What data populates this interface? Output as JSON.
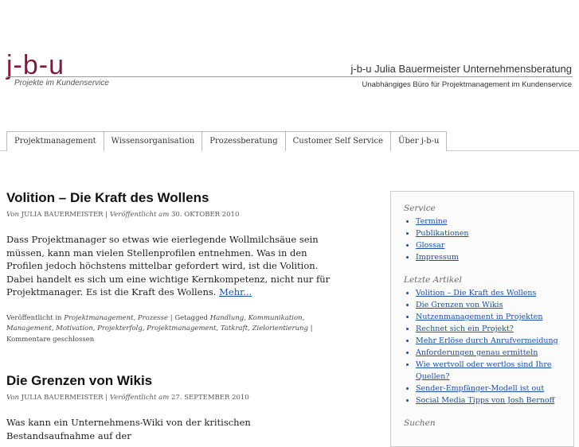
{
  "header": {
    "logo": "j-b-u",
    "tagline": "Projekte im Kundenservice",
    "company_name": "j-b-u Julia Bauermeister Unternehmensberatung",
    "company_sub": "Unabhängiges Büro für Projektmanagement im Kundenservice"
  },
  "nav": {
    "items": [
      {
        "label": "Projektmanagement"
      },
      {
        "label": "Wissensorganisation"
      },
      {
        "label": "Prozessberatung"
      },
      {
        "label": "Customer Self Service"
      },
      {
        "label": "Über j-b-u"
      }
    ]
  },
  "posts": [
    {
      "title": "Volition – Die Kraft des Wollens",
      "by": "Von",
      "author": "JULIA BAUERMEISTER",
      "published_label": "Veröffentlicht am",
      "date": "30. OKTOBER 2010",
      "excerpt": "Dass Projektmanager so etwas wie eierlegende Wollmilchsäue sein müssen, kann man vielen Stellenprofilen entnehmen. Was in den Profilen jedoch höchstens mittelbar gefordert wird, ist die Volition. Dabei handelt es sich um eine wichtige Kernkompetenz, nicht nur für Projektmanager. Es ist die Kraft des Wollens.",
      "more": "Mehr...",
      "category_label": "Veröffentlicht in",
      "categories": "Projektmanagement, Prozesse",
      "tag_label": "Getagged",
      "tags": "Handlung, Kommunikation, Management, Motivation, Projekterfolg, Projektmanagement, Tatkraft, Zielorientierung",
      "comments": "Kommentare geschlossen"
    },
    {
      "title": "Die Grenzen von Wikis",
      "by": "Von",
      "author": "JULIA BAUERMEISTER",
      "published_label": "Veröffentlicht am",
      "date": "27. SEPTEMBER 2010",
      "excerpt": "Was kann ein Unternehmens-Wiki von der kritischen Bestandsaufnahme auf der"
    }
  ],
  "sidebar": {
    "service_title": "Service",
    "service_items": [
      {
        "label": "Termine"
      },
      {
        "label": "Publikationen"
      },
      {
        "label": "Glossar"
      },
      {
        "label": "Impressum"
      }
    ],
    "recent_title": "Letzte Artikel",
    "recent_items": [
      {
        "label": "Volition – Die Kraft des Wollens"
      },
      {
        "label": "Die Grenzen von Wikis"
      },
      {
        "label": "Nutzenmanagement in Projekten"
      },
      {
        "label": "Rechnet sich ein Projekt?"
      },
      {
        "label": "Mehr Erlöse durch Anrufvermeidung"
      },
      {
        "label": "Anforderungen genau ermitteln"
      },
      {
        "label": "Wie wertvoll oder wertlos sind Ihre Quellen?"
      },
      {
        "label": "Sender-Empfänger-Modell ist out"
      },
      {
        "label": "Social Media Tipps von Josh Bernoff"
      }
    ],
    "search_title": "Suchen"
  }
}
